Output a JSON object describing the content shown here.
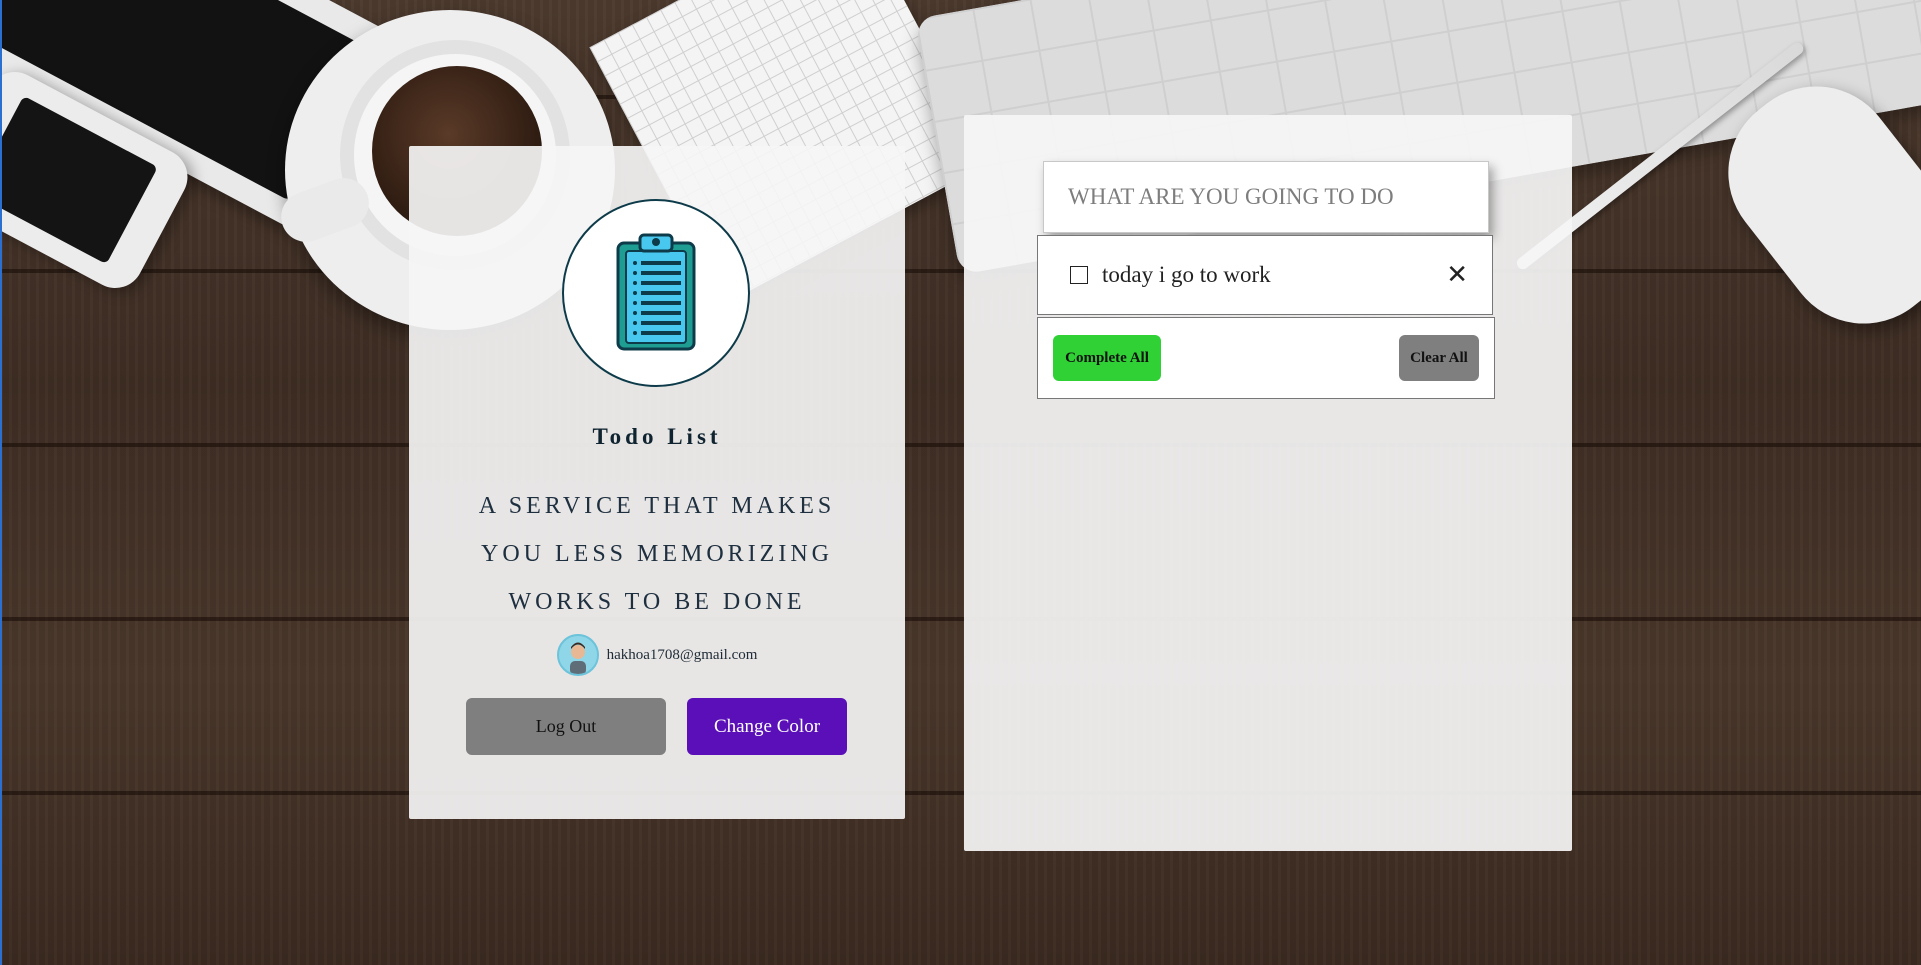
{
  "colors": {
    "accent_purple": "#5a0fb8",
    "complete_green": "#2fd135",
    "neutral_gray": "#7f7f7f",
    "logo_outline": "#0e3b4a",
    "logo_fill": "#48c8ee"
  },
  "profile_card": {
    "logo_icon": "clipboard-list-icon",
    "title": "Todo List",
    "tagline": "A SERVICE THAT MAKES YOU LESS MEMORIZING WORKS TO BE DONE",
    "user": {
      "avatar_icon": "user-avatar-icon",
      "email": "hakhoa1708@gmail.com"
    },
    "logout_label": "Log Out",
    "change_color_label": "Change Color"
  },
  "todo_panel": {
    "input": {
      "placeholder": "WHAT ARE YOU GOING TO DO",
      "value": ""
    },
    "items": [
      {
        "text": "today i go to work",
        "completed": false,
        "delete_icon": "close-icon"
      }
    ],
    "complete_all_label": "Complete All",
    "clear_all_label": "Clear All"
  }
}
